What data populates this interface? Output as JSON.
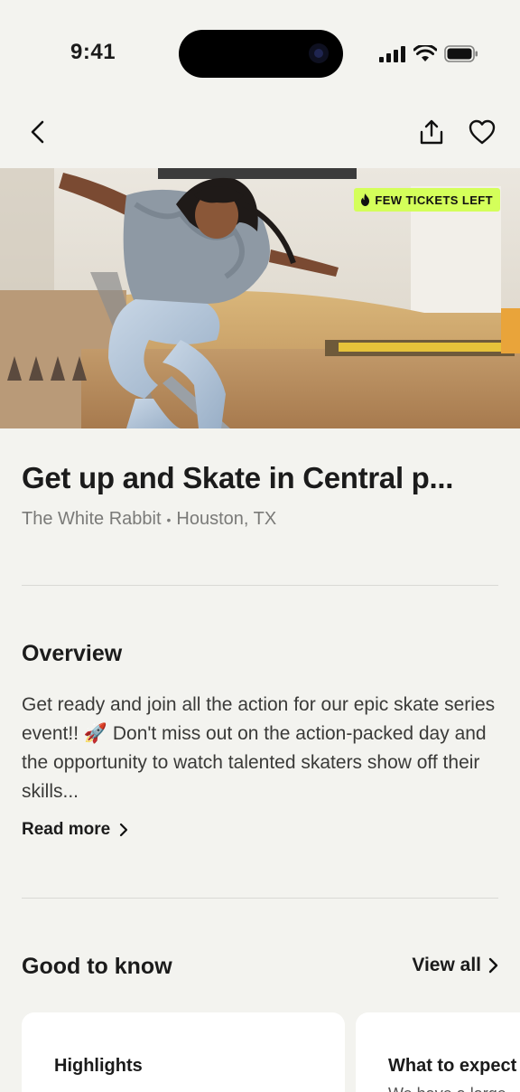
{
  "status_bar": {
    "time": "9:41"
  },
  "event": {
    "badge": "FEW TICKETS LEFT",
    "title": "Get up and Skate in Central p...",
    "venue": "The White Rabbit",
    "separator": "•",
    "location": "Houston, TX"
  },
  "overview": {
    "heading": "Overview",
    "body": "Get ready and join all the action for our epic skate series event!! 🚀 Don't miss out on the action-packed day and the opportunity to watch talented skaters show off their skills...",
    "read_more": "Read more"
  },
  "good_to_know": {
    "heading": "Good to know",
    "view_all": "View all",
    "cards": [
      {
        "title": "Highlights"
      },
      {
        "title": "What to expect",
        "subtitle": "We have a large"
      }
    ]
  },
  "colors": {
    "badge": "#d4ff5a",
    "background": "#f3f3ef"
  },
  "icons": [
    "back-icon",
    "share-icon",
    "heart-icon",
    "flame-icon",
    "chevron-right-icon"
  ]
}
